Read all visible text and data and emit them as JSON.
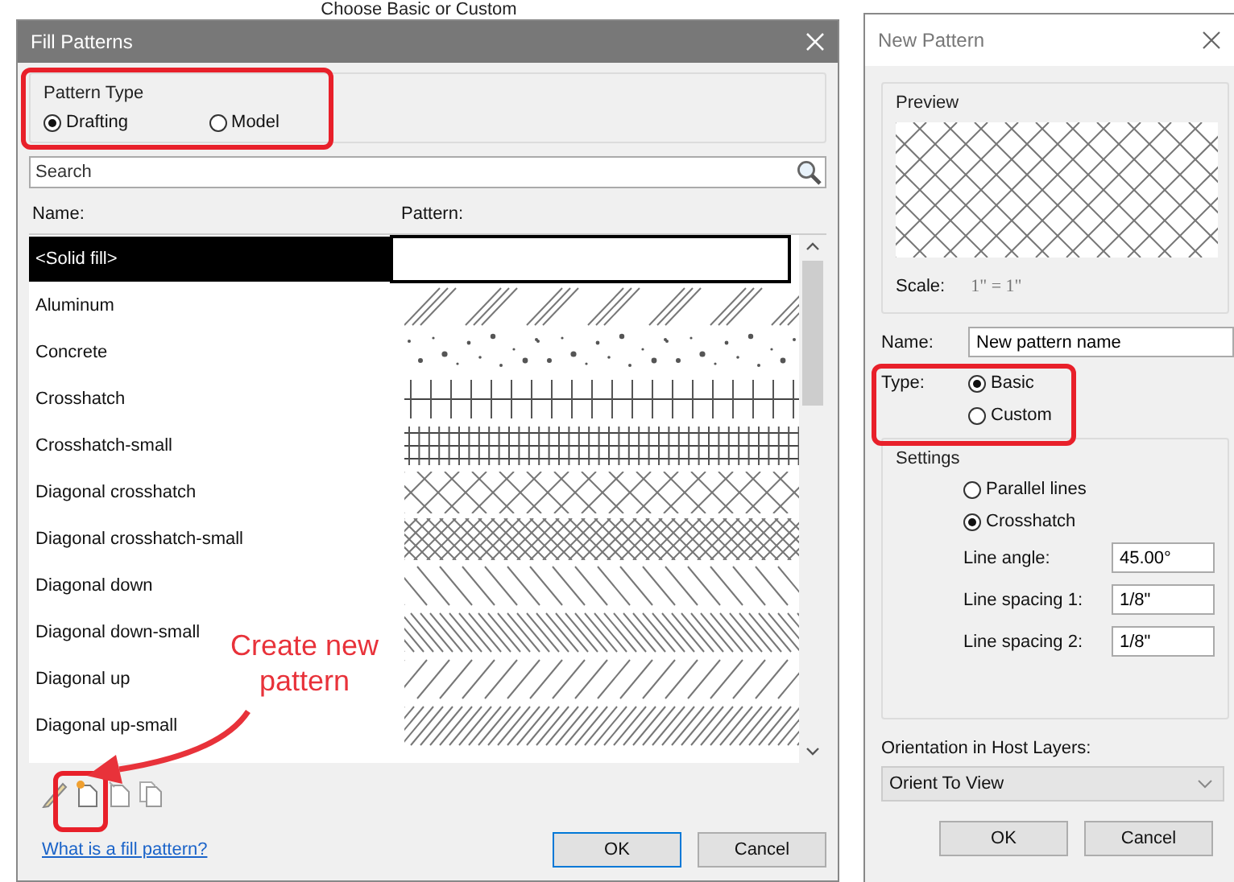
{
  "heading": "Choose Basic or Custom",
  "fill_patterns": {
    "title": "Fill Patterns",
    "pattern_type": {
      "label": "Pattern Type",
      "options": [
        {
          "label": "Drafting",
          "selected": true
        },
        {
          "label": "Model",
          "selected": false
        }
      ]
    },
    "search": {
      "placeholder": "Search"
    },
    "columns": [
      "Name:",
      "Pattern:"
    ],
    "rows": [
      {
        "name": "<Solid fill>",
        "kind": "solid",
        "selected": true
      },
      {
        "name": "Aluminum",
        "kind": "aluminum",
        "selected": false
      },
      {
        "name": "Concrete",
        "kind": "concrete",
        "selected": false
      },
      {
        "name": "Crosshatch",
        "kind": "crosshatch",
        "selected": false
      },
      {
        "name": "Crosshatch-small",
        "kind": "crosshatch-small",
        "selected": false
      },
      {
        "name": "Diagonal crosshatch",
        "kind": "diagonal-crosshatch",
        "selected": false
      },
      {
        "name": "Diagonal crosshatch-small",
        "kind": "diagonal-crosshatch-small",
        "selected": false
      },
      {
        "name": "Diagonal down",
        "kind": "diagonal-down",
        "selected": false
      },
      {
        "name": "Diagonal down-small",
        "kind": "diagonal-down-small",
        "selected": false
      },
      {
        "name": "Diagonal up",
        "kind": "diagonal-up",
        "selected": false
      },
      {
        "name": "Diagonal up-small",
        "kind": "diagonal-up-small",
        "selected": false
      }
    ],
    "link": "What is a fill pattern?",
    "buttons": [
      "OK",
      "Cancel"
    ]
  },
  "new_pattern": {
    "title": "New Pattern",
    "preview": {
      "label": "Preview",
      "scale_label": "Scale:",
      "scale": "1\" = 1\""
    },
    "name": {
      "label": "Name:",
      "value": "New pattern name"
    },
    "type": {
      "label": "Type:",
      "options": [
        {
          "label": "Basic",
          "selected": true
        },
        {
          "label": "Custom",
          "selected": false
        }
      ]
    },
    "settings": {
      "label": "Settings",
      "options": [
        {
          "label": "Parallel lines",
          "selected": false
        },
        {
          "label": "Crosshatch",
          "selected": true
        }
      ],
      "fields": [
        {
          "label": "Line angle:",
          "value": "45.00°"
        },
        {
          "label": "Line spacing 1:",
          "value": "1/8\""
        },
        {
          "label": "Line spacing 2:",
          "value": "1/8\""
        }
      ]
    },
    "orientation": {
      "label": "Orientation in Host Layers:",
      "value": "Orient To View"
    },
    "buttons": [
      "OK",
      "Cancel"
    ]
  },
  "annotation": {
    "text": "Create new pattern"
  }
}
